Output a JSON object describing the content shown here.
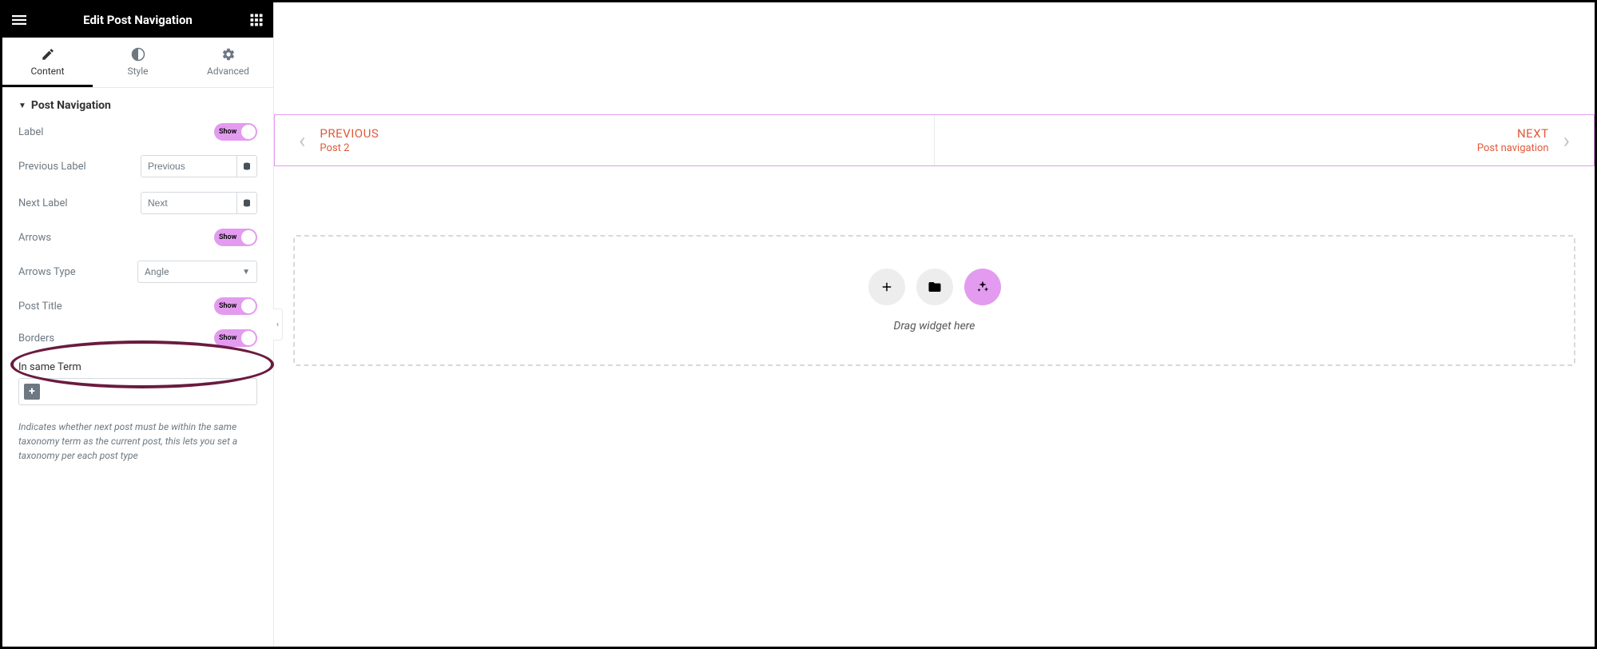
{
  "header": {
    "title": "Edit Post Navigation"
  },
  "tabs": {
    "content": "Content",
    "style": "Style",
    "advanced": "Advanced"
  },
  "section": {
    "title": "Post Navigation"
  },
  "controls": {
    "label_lbl": "Label",
    "show": "Show",
    "prev_label_lbl": "Previous Label",
    "prev_label_val": "Previous",
    "next_label_lbl": "Next Label",
    "next_label_val": "Next",
    "arrows_lbl": "Arrows",
    "arrows_type_lbl": "Arrows Type",
    "arrows_type_val": "Angle",
    "post_title_lbl": "Post Title",
    "borders_lbl": "Borders",
    "in_same_term_lbl": "In same Term",
    "help": "Indicates whether next post must be within the same taxonomy term as the current post, this lets you set a taxonomy per each post type"
  },
  "preview": {
    "prev_label": "PREVIOUS",
    "prev_title": "Post 2",
    "next_label": "NEXT",
    "next_title": "Post navigation"
  },
  "dropzone": {
    "label": "Drag widget here"
  }
}
